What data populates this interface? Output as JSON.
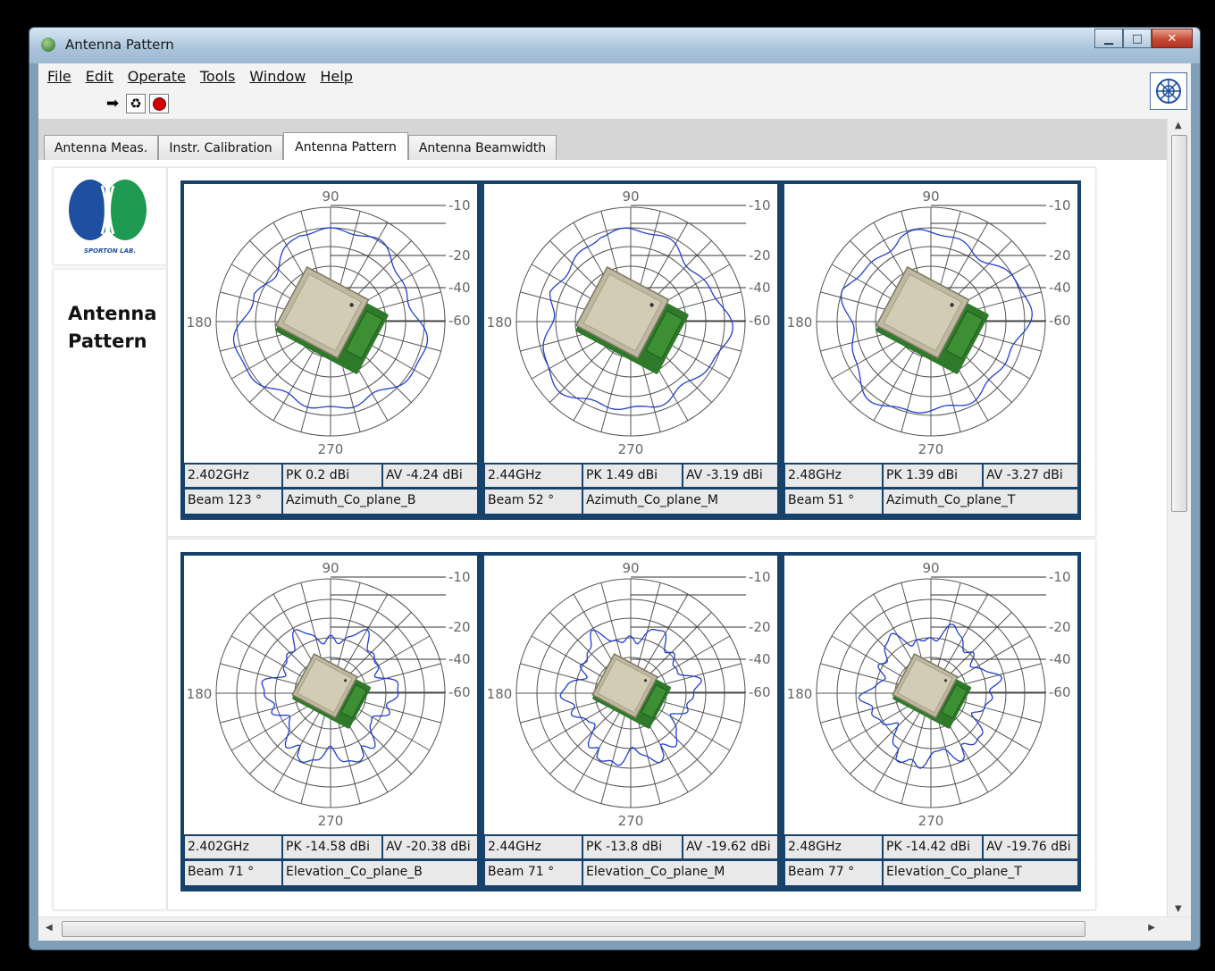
{
  "window": {
    "title": "Antenna Pattern"
  },
  "menu": [
    "File",
    "Edit",
    "Operate",
    "Tools",
    "Window",
    "Help"
  ],
  "tabs": [
    "Antenna Meas.",
    "Instr. Calibration",
    "Antenna Pattern",
    "Antenna Beamwidth"
  ],
  "active_tab": "Antenna Pattern",
  "logo": {
    "caption": "SPORTON LAB."
  },
  "heading": "Antenna Pattern",
  "polar_labels": {
    "top": "90",
    "left": "180",
    "bottom": "270",
    "rings": [
      "10",
      "20",
      "40",
      "60"
    ]
  },
  "colors": {
    "frame": "#16426c",
    "trace": "#2040d0",
    "cell_bg": "#e9e9e9"
  },
  "icons": {
    "run": "arrow-right-icon",
    "continuous": "recycle-icon",
    "stop": "stop-icon",
    "help": "globe-grid-icon"
  },
  "charts": [
    {
      "freq": "2.402GHz",
      "pk": "PK 0.2 dBi",
      "av": "AV -4.24 dBi",
      "beam": "Beam 123 °",
      "name": "Azimuth_Co_plane_B",
      "pattern": "smooth"
    },
    {
      "freq": "2.44GHz",
      "pk": "PK 1.49 dBi",
      "av": "AV -3.19 dBi",
      "beam": "Beam 52 °",
      "name": "Azimuth_Co_plane_M",
      "pattern": "smooth"
    },
    {
      "freq": "2.48GHz",
      "pk": "PK 1.39 dBi",
      "av": "AV -3.27 dBi",
      "beam": "Beam 51 °",
      "name": "Azimuth_Co_plane_T",
      "pattern": "smooth"
    },
    {
      "freq": "2.402GHz",
      "pk": "PK -14.58 dBi",
      "av": "AV -20.38 dBi",
      "beam": "Beam 71 °",
      "name": "Elevation_Co_plane_B",
      "pattern": "lobed"
    },
    {
      "freq": "2.44GHz",
      "pk": "PK -13.8 dBi",
      "av": "AV -19.62 dBi",
      "beam": "Beam 71 °",
      "name": "Elevation_Co_plane_M",
      "pattern": "lobed"
    },
    {
      "freq": "2.48GHz",
      "pk": "PK -14.42 dBi",
      "av": "AV -19.76 dBi",
      "beam": "Beam 77 °",
      "name": "Elevation_Co_plane_T",
      "pattern": "lobed"
    }
  ]
}
